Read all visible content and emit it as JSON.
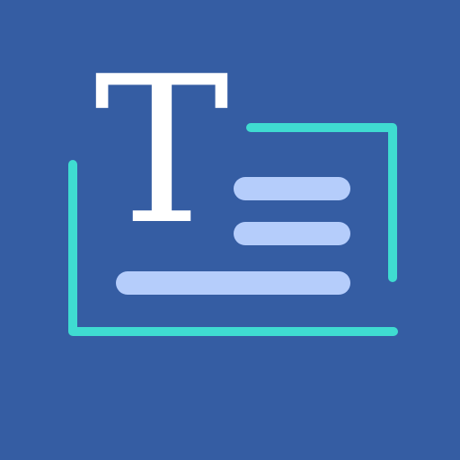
{
  "app_icon": {
    "glyph": "T",
    "icon_name": "text-document-scan-icon"
  },
  "colors": {
    "background": "#355da3",
    "frame": "#3fdcd1",
    "lines": "#b5cdfb",
    "glyph": "#ffffff"
  }
}
